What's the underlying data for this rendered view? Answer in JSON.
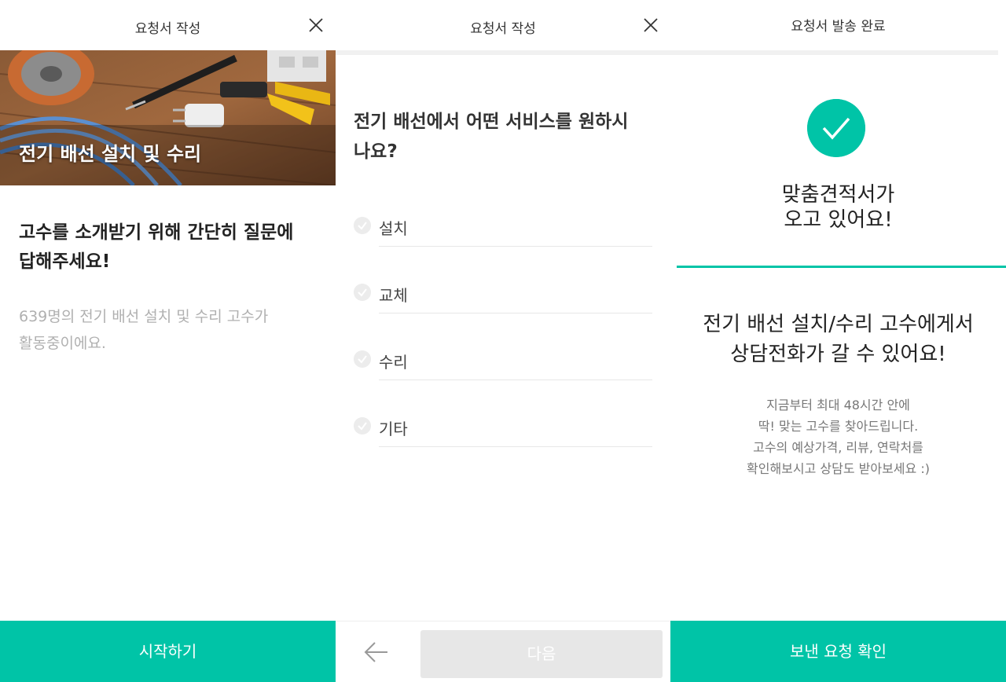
{
  "panel1": {
    "header_title": "요청서 작성",
    "hero_caption": "전기 배선 설치 및 수리",
    "heading_line1": "고수를 소개받기 위해 간단히 질문에",
    "heading_line2": "답해주세요!",
    "sub_line1": "639명의 전기 배선 설치 및 수리 고수가",
    "sub_line2": "활동중이에요.",
    "start_button": "시작하기"
  },
  "panel2": {
    "header_title": "요청서 작성",
    "question_line1": "전기 배선에서 어떤 서비스를 원하시",
    "question_line2": "나요?",
    "options": [
      {
        "label": "설치"
      },
      {
        "label": "교체"
      },
      {
        "label": "수리"
      },
      {
        "label": "기타"
      }
    ],
    "next_button": "다음"
  },
  "panel3": {
    "header_title": "요청서 발송 완료",
    "done_title_line1": "맞춤견적서가",
    "done_title_line2": "오고 있어요!",
    "main_line1": "전기 배선 설치/수리 고수에게서",
    "main_line2": "상담전화가 갈 수 있어요!",
    "sub_line1": "지금부터 최대 48시간 안에",
    "sub_line2": "딱! 맞는 고수를 찾아드립니다.",
    "sub_line3": "고수의 예상가격, 리뷰, 연락처를",
    "sub_line4": "확인해보시고 상담도 받아보세요 :)",
    "confirm_button": "보낸 요청 확인"
  },
  "icons": {
    "close": "close-icon",
    "check": "check-icon",
    "back": "arrow-left-icon"
  },
  "colors": {
    "accent": "#00c4a7",
    "disabled_button": "#e7e7e7"
  }
}
